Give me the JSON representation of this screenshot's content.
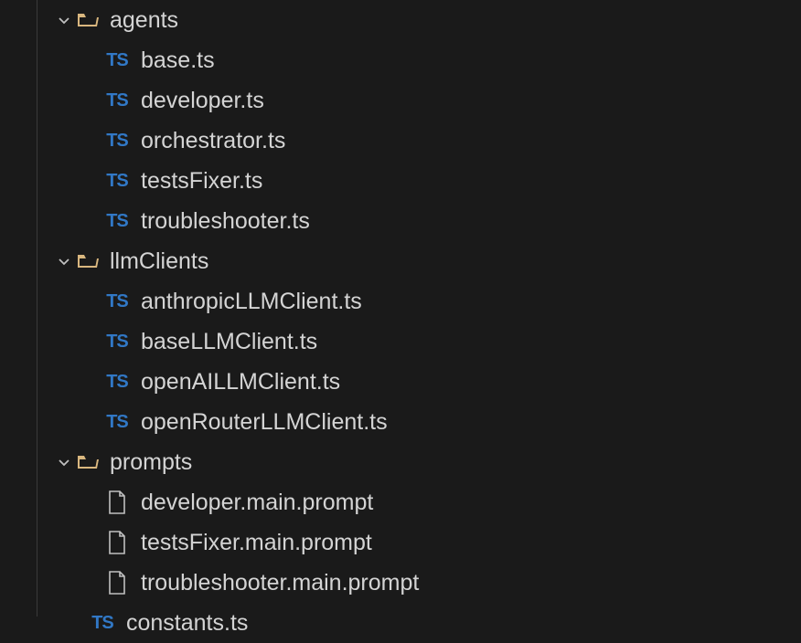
{
  "colors": {
    "background": "#1a1a1a",
    "text": "#d4d4d4",
    "tsIcon": "#3178c6",
    "folderIcon": "#d9b77f",
    "chevron": "#c0c0c0",
    "fileOutline": "#c0c0c0"
  },
  "tree": {
    "folders": [
      {
        "name": "agents",
        "expanded": true,
        "files": [
          {
            "name": "base.ts",
            "type": "ts"
          },
          {
            "name": "developer.ts",
            "type": "ts"
          },
          {
            "name": "orchestrator.ts",
            "type": "ts"
          },
          {
            "name": "testsFixer.ts",
            "type": "ts"
          },
          {
            "name": "troubleshooter.ts",
            "type": "ts"
          }
        ]
      },
      {
        "name": "llmClients",
        "expanded": true,
        "files": [
          {
            "name": "anthropicLLMClient.ts",
            "type": "ts"
          },
          {
            "name": "baseLLMClient.ts",
            "type": "ts"
          },
          {
            "name": "openAILLMClient.ts",
            "type": "ts"
          },
          {
            "name": "openRouterLLMClient.ts",
            "type": "ts"
          }
        ]
      },
      {
        "name": "prompts",
        "expanded": true,
        "files": [
          {
            "name": "developer.main.prompt",
            "type": "generic"
          },
          {
            "name": "testsFixer.main.prompt",
            "type": "generic"
          },
          {
            "name": "troubleshooter.main.prompt",
            "type": "generic"
          }
        ]
      }
    ],
    "rootFiles": [
      {
        "name": "constants.ts",
        "type": "ts"
      }
    ]
  }
}
